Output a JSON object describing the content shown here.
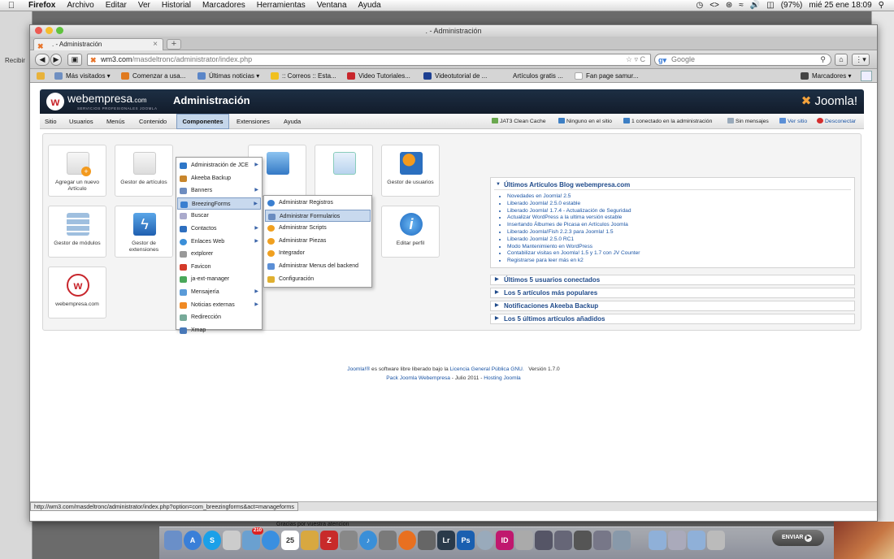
{
  "os_menubar": {
    "app": "Firefox",
    "items": [
      "Archivo",
      "Editar",
      "Ver",
      "Historial",
      "Marcadores",
      "Herramientas",
      "Ventana",
      "Ayuda"
    ],
    "battery": "(97%)",
    "datetime": "mié 25 ene  18:09"
  },
  "bg_window": {
    "label": "Recibir"
  },
  "browser": {
    "window_title": ". - Administración",
    "tab_title": ". - Administración",
    "url_host": "wm3.com",
    "url_path": "/masdeltronc/administrator/index.php",
    "search_placeholder": "Google",
    "bookmarks": [
      "Más visitados ▾",
      "Comenzar a usa...",
      "Últimas noticias ▾",
      ":: Correos :: Esta...",
      "Video Tutoriales...",
      "Videotutorial de ...",
      "Artículos gratis ...",
      "Fan page samur..."
    ],
    "bookmarks_menu": "Marcadores ▾",
    "status_url": "http://wm3.com/masdeltronc/administrator/index.php?option=com_breezingforms&act=manageforms"
  },
  "joomla": {
    "brand": "webempresa",
    "brand_suffix": ".com",
    "brand_tag": "SERVICIOS PROFESIONALES JOOMLA",
    "page_title": "Administración",
    "joomla_logo": "Joomla!",
    "menu": [
      "Sitio",
      "Usuarios",
      "Menús",
      "Contenido",
      "Componentes",
      "Extensiones",
      "Ayuda"
    ],
    "status": [
      "JAT3 Clean Cache",
      "Ninguno en el sitio",
      "1 conectado en la administración",
      "Sin mensajes",
      "Ver sitio",
      "Desconectar"
    ],
    "quickicons": [
      {
        "label": "Agregar un nuevo Artículo"
      },
      {
        "label": "Gestor de artículos"
      },
      {
        "label": "Gestor de usuarios"
      },
      {
        "label": "Gestor de módulos"
      },
      {
        "label": "Gestor de extensiones"
      },
      {
        "label": "Editar perfil"
      },
      {
        "label": "webempresa.com"
      }
    ],
    "components_menu": [
      {
        "label": "Administración de JCE",
        "sub": true
      },
      {
        "label": "Akeeba Backup",
        "sub": false
      },
      {
        "label": "Banners",
        "sub": true
      },
      {
        "label": "BreezingForms",
        "sub": true
      },
      {
        "label": "Buscar",
        "sub": false
      },
      {
        "label": "Contactos",
        "sub": true
      },
      {
        "label": "Enlaces Web",
        "sub": true
      },
      {
        "label": "extplorer",
        "sub": false
      },
      {
        "label": "Favicon",
        "sub": false
      },
      {
        "label": "ja-ext-manager",
        "sub": false
      },
      {
        "label": "Mensajería",
        "sub": true
      },
      {
        "label": "Noticias externas",
        "sub": true
      },
      {
        "label": "Redirección",
        "sub": false
      },
      {
        "label": "Xmap",
        "sub": false
      }
    ],
    "breezing_submenu": [
      "Administrar Registros",
      "Administrar Formularios",
      "Administrar Scripts",
      "Administrar Piezas",
      "Integrador",
      "Administrar Menus del backend",
      "Configuración"
    ],
    "modules": {
      "blog_title": "Últimos Artículos Blog webempresa.com",
      "blog_items": [
        "Novedades en Joomla! 2.5",
        "Liberado Joomla! 2.5.0 estable",
        "Liberado Joomla! 1.7.4 - Actualización de Seguridad",
        "Actualizar WordPress a la ultima versión estable",
        "Insertando Álbumes de Picasa en Artículos Joomla",
        "Liberado Joomla!Fish 2.2.3 para Joomla! 1.5",
        "Liberado Joomla! 2.5.0 RC1",
        "Modo Mantenimiento en WordPress",
        "Contabilizar visitas en Joomla! 1.5 y 1.7 con JV Counter",
        "Registrarse para leer más en k2"
      ],
      "collapsed": [
        "Últimos 5 usuarios conectados",
        "Los 5 artículos más populares",
        "Notificaciones Akeeba Backup",
        "Los 5 últimos artículos añadidos"
      ]
    },
    "footer": {
      "joomla_link": "Joomla!®",
      "text1": " es software libre liberado bajo la ",
      "license": "Licencia General Pública GNU.",
      "version": "Versión 1.7.0",
      "pack": "Pack Joomla Webempresa",
      "date": " - Julio 2011 - ",
      "hosting": "Hosting Joomla"
    }
  },
  "dock": {
    "notification": "Gracias por vuestra atencion",
    "send_button": "ENVIAR",
    "badge": "210",
    "calendar_day": "25"
  },
  "colors": {
    "joomla_header": "#1d2f44",
    "link": "#1b55a5",
    "menu_highlight": "#c8d9ee"
  }
}
